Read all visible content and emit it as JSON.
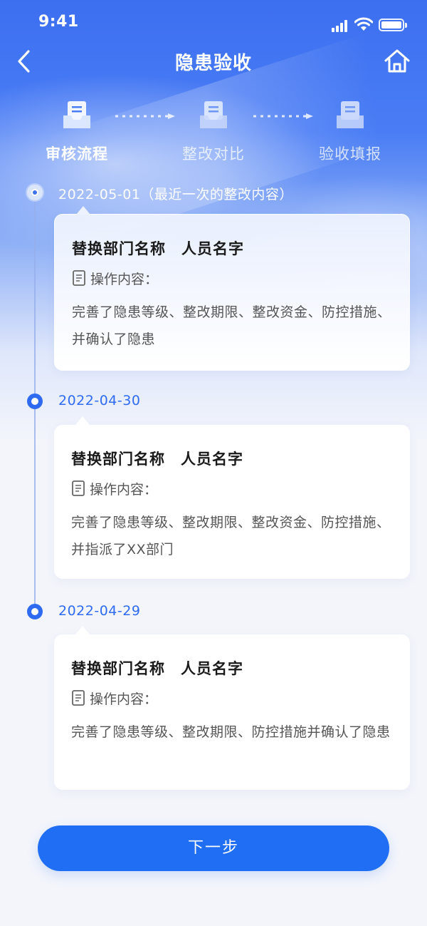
{
  "status_bar": {
    "time": "9:41"
  },
  "nav": {
    "title": "隐患验收",
    "back_icon": "chevron-left-icon",
    "home_icon": "home-icon"
  },
  "steps": [
    {
      "label": "审核流程",
      "active": true
    },
    {
      "label": "整改对比",
      "active": false
    },
    {
      "label": "验收填报",
      "active": false
    }
  ],
  "timeline": [
    {
      "date": "2022-05-01（最近一次的整改内容）",
      "title": "替换部门名称　人员名字",
      "op_label": "操作内容：",
      "content": "完善了隐患等级、整改期限、整改资金、防控措施、并确认了隐患"
    },
    {
      "date": "2022-04-30",
      "title": "替换部门名称　人员名字",
      "op_label": "操作内容：",
      "content": "完善了隐患等级、整改期限、整改资金、防控措施、并指派了XX部门"
    },
    {
      "date": "2022-04-29",
      "title": "替换部门名称　人员名字",
      "op_label": "操作内容：",
      "content": "完善了隐患等级、整改期限、防控措施并确认了隐患"
    }
  ],
  "next_button": "下一步",
  "colors": {
    "primary": "#1f6ef3",
    "header_blue": "#3c6ff0"
  }
}
